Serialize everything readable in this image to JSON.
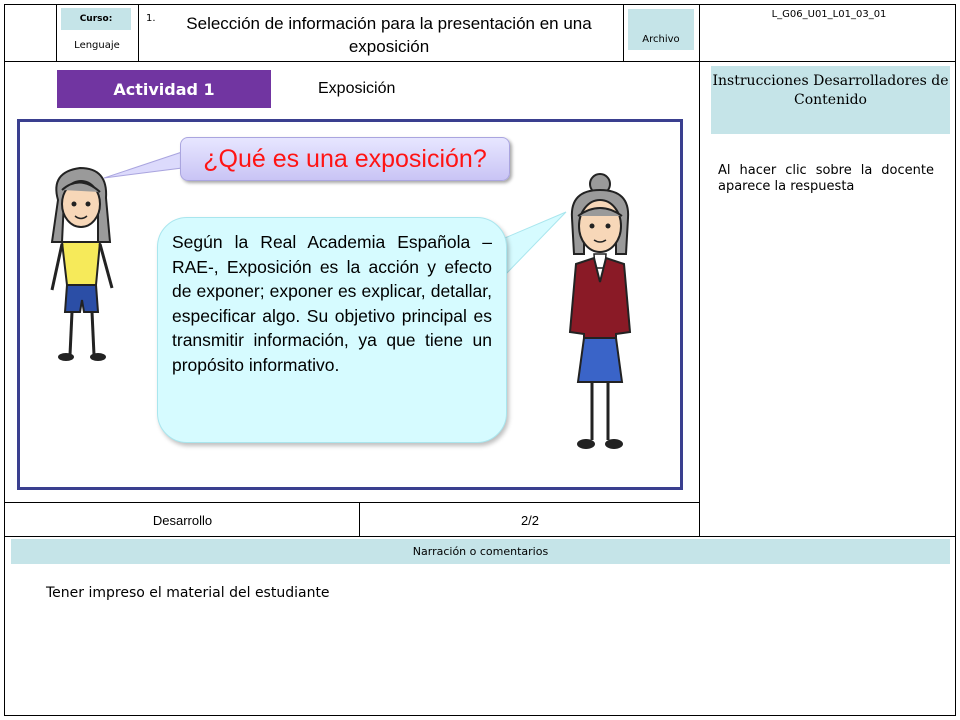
{
  "header": {
    "curso_label": "Curso:",
    "subject": "Lenguaje",
    "number": "1.",
    "title": "Selección de información para la presentación en una exposición",
    "archivo_label": "Archivo",
    "code": "L_G06_U01_L01_03_01"
  },
  "activity": {
    "button_label": "Actividad 1",
    "topic": "Exposición"
  },
  "scene": {
    "question": "¿Qué es una exposición?",
    "answer": "Según la Real Academia Española –RAE-, Exposición es la acción y efecto de exponer; exponer es explicar, detallar, especificar algo. Su objetivo principal es transmitir información, ya que tiene un propósito informativo."
  },
  "sidebar": {
    "instructions_title": "Instrucciones Desarrolladores de Contenido",
    "instructions_text": "Al hacer clic sobre la docente aparece la respuesta"
  },
  "footer_row": {
    "section": "Desarrollo",
    "page": "2/2"
  },
  "narration": {
    "title": "Narración o comentarios",
    "text": "Tener impreso el material del estudiante"
  },
  "colors": {
    "accent_purple": "#7135a1",
    "panel_teal": "#c5e4e8",
    "question_red": "#ff1414",
    "stage_border": "#3a3f8f"
  }
}
